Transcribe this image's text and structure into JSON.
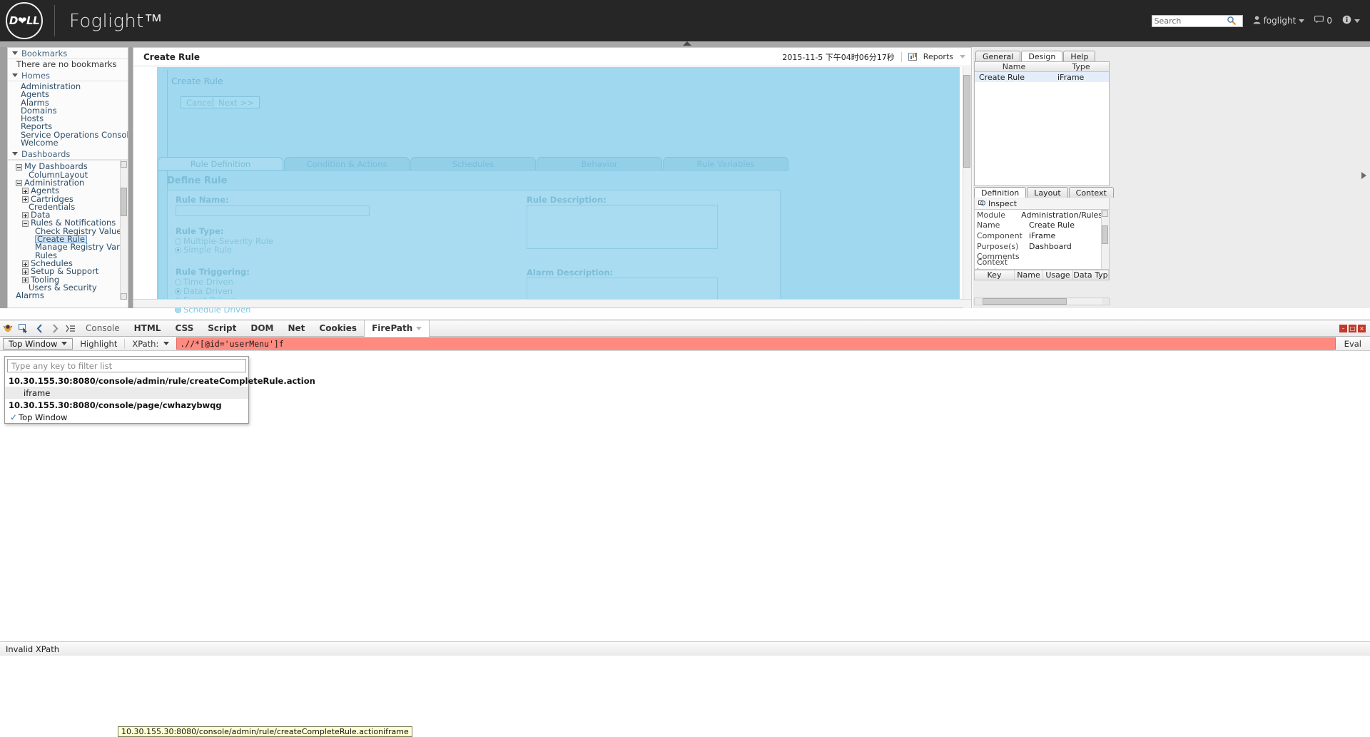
{
  "header": {
    "logo_text": "D❤LL",
    "product_title": "Foglight™",
    "search_placeholder": "Search",
    "search_value": "",
    "user_label": "foglight",
    "message_count": "0",
    "info_label": ""
  },
  "leftnav": {
    "bookmarks_header": "Bookmarks",
    "bookmarks_empty": "There are no bookmarks",
    "homes_header": "Homes",
    "homes": [
      "Administration",
      "Agents",
      "Alarms",
      "Domains",
      "Hosts",
      "Reports",
      "Service Operations Console",
      "Welcome"
    ],
    "dashboards_header": "Dashboards",
    "tree": [
      {
        "label": "My Dashboards",
        "indent": 1,
        "toggle": "minus"
      },
      {
        "label": "ColumnLayout",
        "indent": 3,
        "toggle": "none"
      },
      {
        "label": "Administration",
        "indent": 1,
        "toggle": "minus"
      },
      {
        "label": "Agents",
        "indent": 2,
        "toggle": "plus"
      },
      {
        "label": "Cartridges",
        "indent": 2,
        "toggle": "plus"
      },
      {
        "label": "Credentials",
        "indent": 3,
        "toggle": "none"
      },
      {
        "label": "Data",
        "indent": 2,
        "toggle": "plus"
      },
      {
        "label": "Rules & Notifications",
        "indent": 2,
        "toggle": "minus"
      },
      {
        "label": "Check Registry Value",
        "indent": 4,
        "toggle": "none"
      },
      {
        "label": "Create Rule",
        "indent": 4,
        "toggle": "none",
        "selected": true
      },
      {
        "label": "Manage Registry Variables",
        "indent": 4,
        "toggle": "none"
      },
      {
        "label": "Rules",
        "indent": 4,
        "toggle": "none"
      },
      {
        "label": "Schedules",
        "indent": 2,
        "toggle": "plus"
      },
      {
        "label": "Setup & Support",
        "indent": 2,
        "toggle": "plus"
      },
      {
        "label": "Tooling",
        "indent": 2,
        "toggle": "plus"
      },
      {
        "label": "Users & Security",
        "indent": 3,
        "toggle": "none"
      },
      {
        "label": "Alarms",
        "indent": 1,
        "toggle": "none"
      }
    ]
  },
  "main": {
    "title": "Create Rule",
    "timestamp": "2015-11-5 下午04时06分17秒",
    "reports_label": "Reports",
    "iframe": {
      "inner_title": "Create Rule",
      "cancel_label": "Cancel",
      "next_label": "Next >>",
      "tabs": [
        "Rule Definition",
        "Condition & Actions",
        "Schedules",
        "Behavior",
        "Rule Variables"
      ],
      "active_tab": "Rule Definition",
      "section_title": "Define Rule",
      "rule_name_label": "Rule Name:",
      "rule_name_value": "",
      "rule_type_label": "Rule Type:",
      "rule_type_options": [
        "Multiple-Severity Rule",
        "Simple Rule"
      ],
      "rule_type_selected": "Simple Rule",
      "rule_triggering_label": "Rule Triggering:",
      "rule_triggering_options": [
        "Time Driven",
        "Data Driven",
        "Event Driven",
        "Schedule Driven"
      ],
      "rule_triggering_selected": "Data Driven",
      "rule_description_label": "Rule Description:",
      "rule_description_value": "",
      "alarm_description_label": "Alarm Description:",
      "alarm_description_value": ""
    }
  },
  "rightpanel": {
    "tabs": [
      "General",
      "Design",
      "Help"
    ],
    "active_tab": "Design",
    "table_headers": [
      "Name",
      "Type"
    ],
    "table_rows": [
      {
        "name": "Create Rule",
        "type": "iFrame"
      }
    ],
    "lower_tabs": [
      "Definition",
      "Layout",
      "Context"
    ],
    "active_lower_tab": "Definition",
    "inspect_label": "Inspect",
    "properties": [
      {
        "key": "Module",
        "value": "Administration/Rules & No"
      },
      {
        "key": "Name",
        "value": "Create Rule"
      },
      {
        "key": "Component",
        "value": "iFrame"
      },
      {
        "key": "Purpose(s)",
        "value": "Dashboard"
      },
      {
        "key": "Comments",
        "value": ""
      },
      {
        "key": "Context Inputs",
        "value": ""
      }
    ],
    "context_headers": [
      "Key",
      "Name",
      "Usage",
      "Data Typ"
    ]
  },
  "firebug": {
    "panels": [
      "Console",
      "HTML",
      "CSS",
      "Script",
      "DOM",
      "Net",
      "Cookies"
    ],
    "active_panel": "FirePath",
    "active_panel_label": "FirePath",
    "window_buttons": [
      "–",
      "□",
      "×"
    ],
    "firepath": {
      "window_selector": "Top Window",
      "highlight_label": "Highlight",
      "xpath_label": "XPath:",
      "xpath_value": ".//*[@id='userMenu']f",
      "eval_label": "Eval",
      "dropdown": {
        "filter_placeholder": "Type any key to filter list",
        "items": [
          {
            "label": "10.30.155.30:8080/console/admin/rule/createCompleteRule.action",
            "bold": true,
            "indent": false
          },
          {
            "label": "iframe",
            "bold": false,
            "indent": true
          },
          {
            "label": "10.30.155.30:8080/console/page/cwhazybwqg",
            "bold": true,
            "indent": false
          },
          {
            "label": "Top Window",
            "bold": false,
            "indent": false,
            "checked": true
          }
        ]
      },
      "tooltip": "10.30.155.30:8080/console/admin/rule/createCompleteRule.actioniframe"
    },
    "statusbar": "Invalid XPath"
  }
}
